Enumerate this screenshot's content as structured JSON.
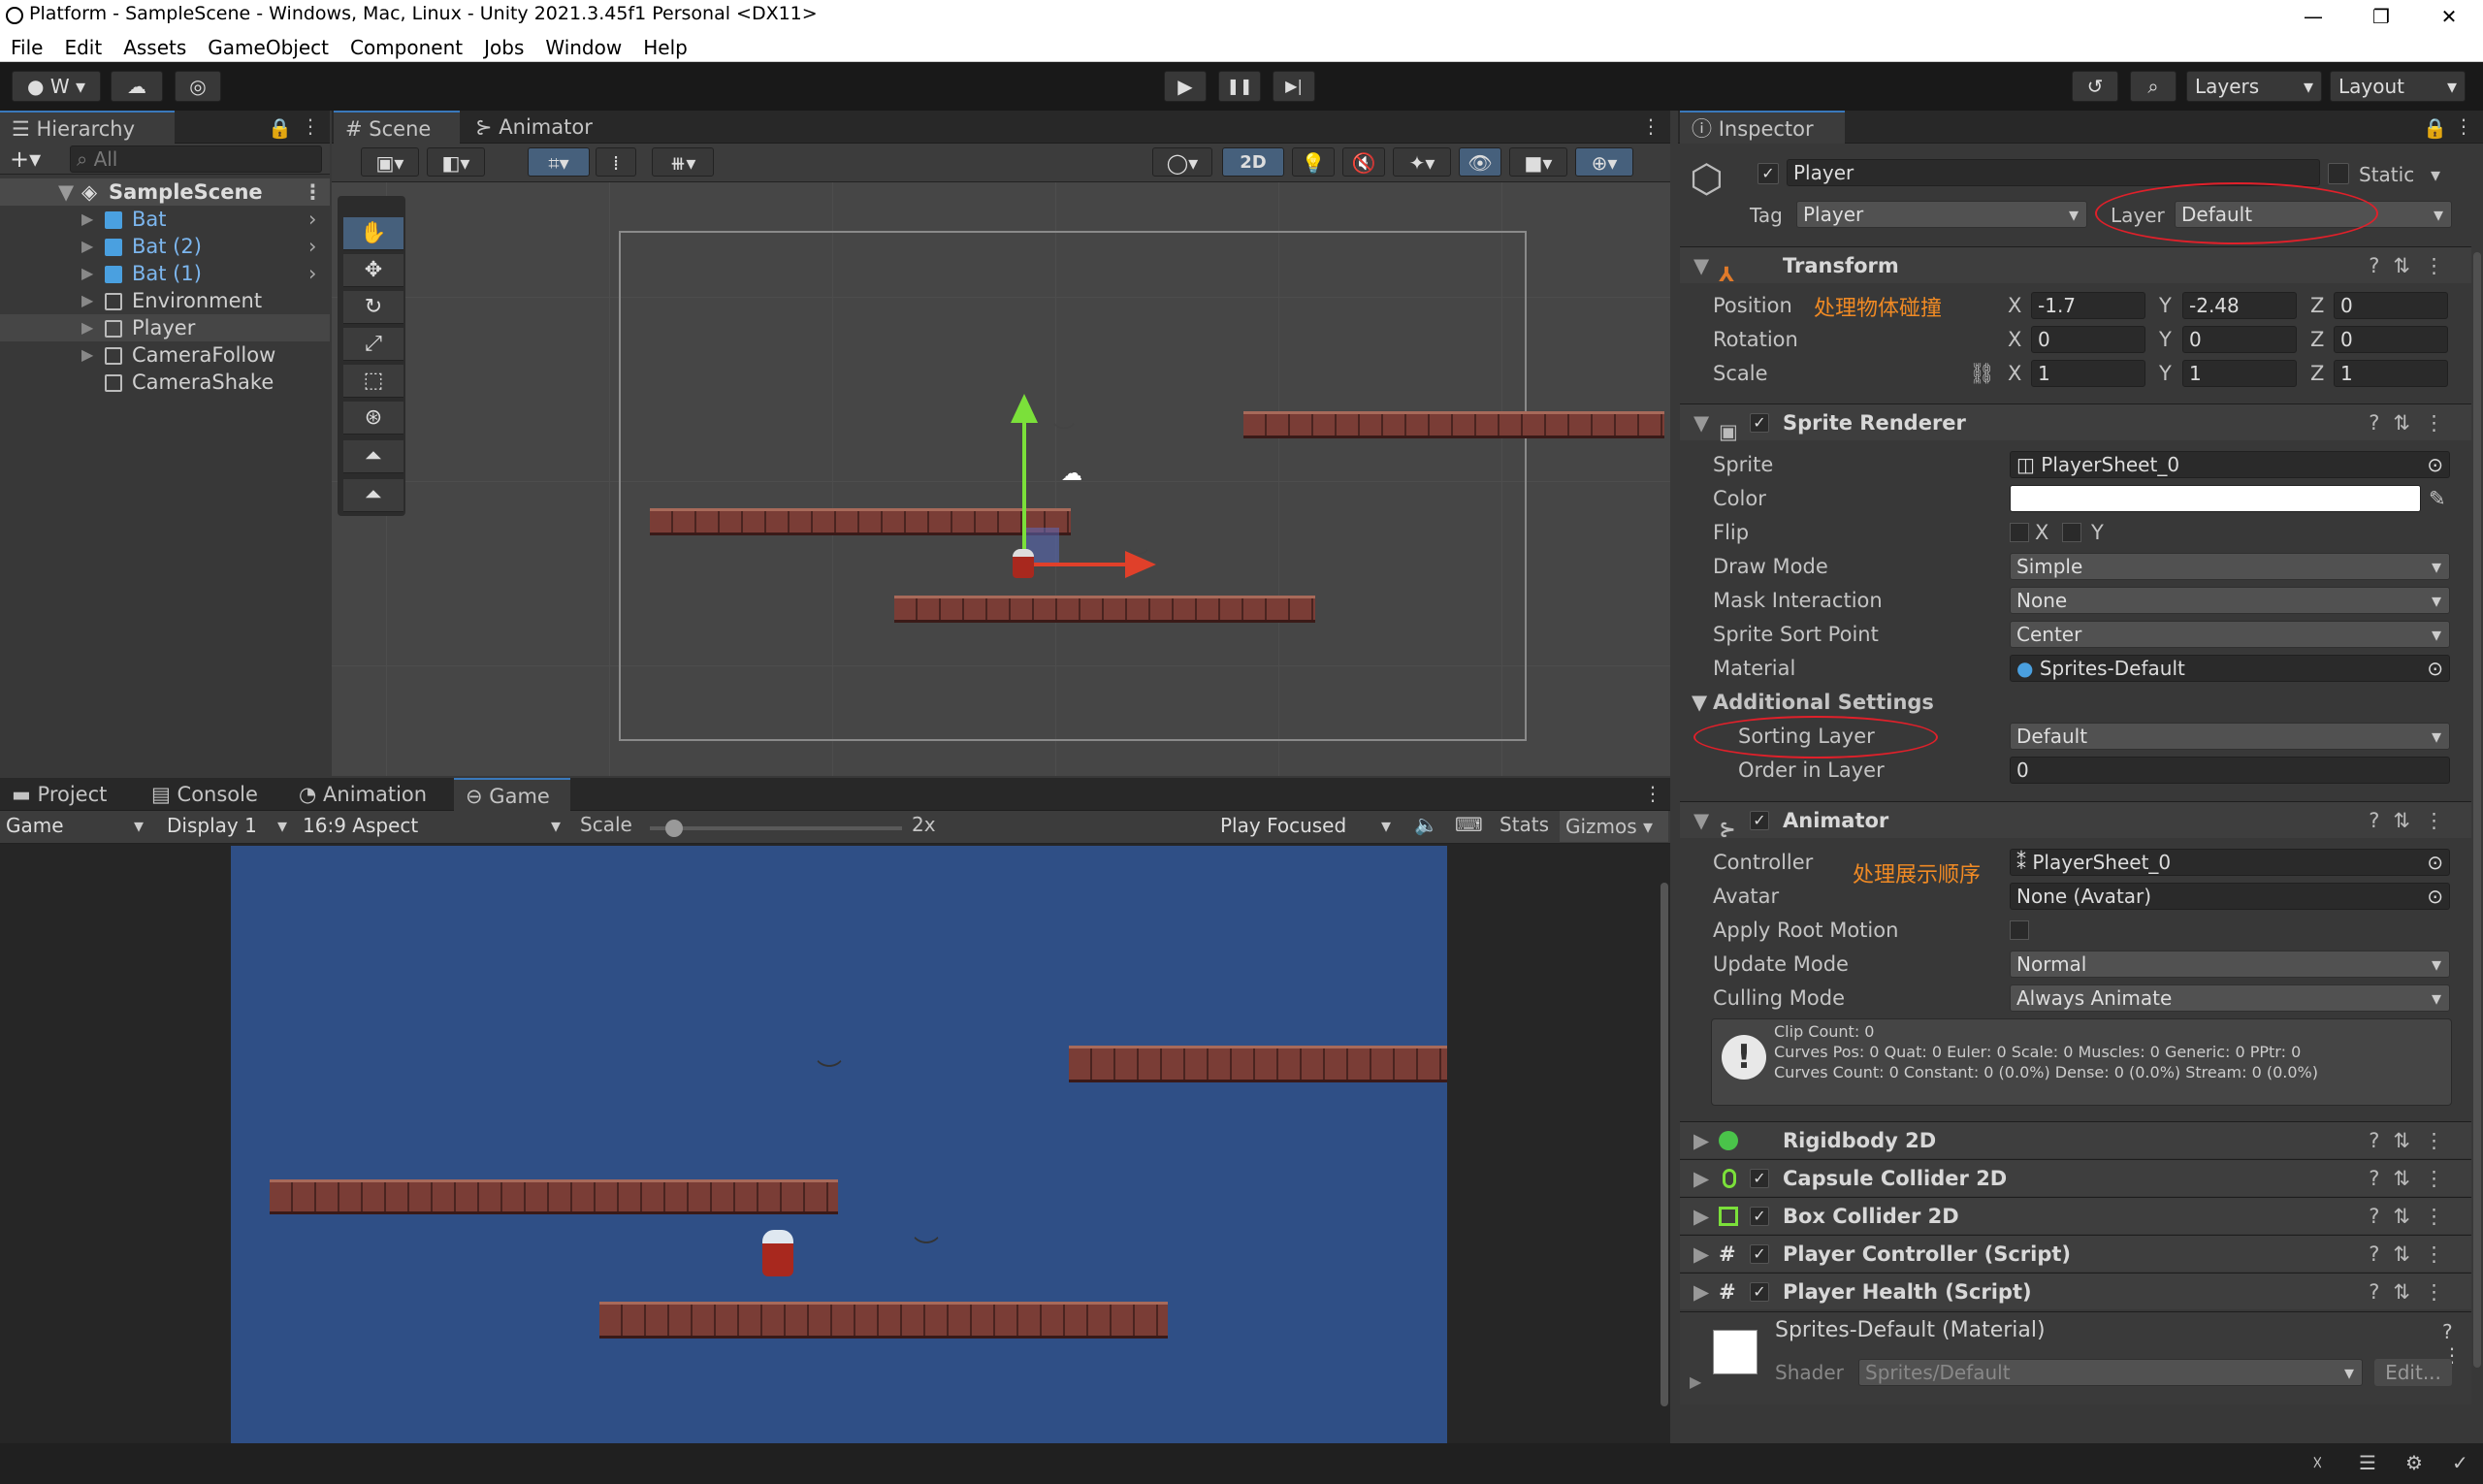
{
  "window": {
    "title": "Platform - SampleScene - Windows, Mac, Linux - Unity 2021.3.45f1 Personal <DX11>",
    "min": "—",
    "max": "❐",
    "close": "✕"
  },
  "menu": [
    "File",
    "Edit",
    "Assets",
    "GameObject",
    "Component",
    "Jobs",
    "Window",
    "Help"
  ],
  "toolbar": {
    "account": "W",
    "layers": "Layers",
    "layout": "Layout",
    "play": "▶",
    "pause": "❚❚",
    "step": "▶|"
  },
  "hierarchy": {
    "tab": "Hierarchy",
    "search_placeholder": "All",
    "scene": "SampleScene",
    "items": [
      {
        "label": "Bat",
        "prefab": true
      },
      {
        "label": "Bat (2)",
        "prefab": true
      },
      {
        "label": "Bat (1)",
        "prefab": true
      },
      {
        "label": "Environment",
        "prefab": false
      },
      {
        "label": "Player",
        "prefab": false
      },
      {
        "label": "CameraFollow",
        "prefab": false
      },
      {
        "label": "CameraShake",
        "prefab": false
      }
    ]
  },
  "scene_tabs": {
    "scene": "Scene",
    "animator": "Animator",
    "mode_2d": "2D"
  },
  "bottom_tabs": {
    "project": "Project",
    "console": "Console",
    "animation": "Animation",
    "game": "Game"
  },
  "game_bar": {
    "game": "Game",
    "display": "Display 1",
    "aspect": "16:9 Aspect",
    "scale_label": "Scale",
    "scale_value": "2x",
    "play_focused": "Play Focused",
    "stats": "Stats",
    "gizmos": "Gizmos"
  },
  "inspector": {
    "tab": "Inspector",
    "object_name": "Player",
    "static_label": "Static",
    "tag_label": "Tag",
    "tag_value": "Player",
    "layer_label": "Layer",
    "layer_value": "Default",
    "transform": {
      "title": "Transform",
      "note": "处理物体碰撞",
      "position_label": "Position",
      "pos": {
        "x": "-1.7",
        "y": "-2.48",
        "z": "0"
      },
      "rotation_label": "Rotation",
      "rot": {
        "x": "0",
        "y": "0",
        "z": "0"
      },
      "scale_label": "Scale",
      "scl": {
        "x": "1",
        "y": "1",
        "z": "1"
      },
      "x": "X",
      "y": "Y",
      "z": "Z"
    },
    "sprite_renderer": {
      "title": "Sprite Renderer",
      "sprite_label": "Sprite",
      "sprite_value": "PlayerSheet_0",
      "color_label": "Color",
      "color_value": "#ffffff",
      "flip_label": "Flip",
      "flip_x": "X",
      "flip_y": "Y",
      "draw_mode_label": "Draw Mode",
      "draw_mode": "Simple",
      "mask_label": "Mask Interaction",
      "mask": "None",
      "sort_point_label": "Sprite Sort Point",
      "sort_point": "Center",
      "material_label": "Material",
      "material": "Sprites-Default",
      "additional": "Additional Settings",
      "sorting_layer_label": "Sorting Layer",
      "sorting_layer": "Default",
      "order_label": "Order in Layer",
      "order": "0"
    },
    "animator": {
      "title": "Animator",
      "note": "处理展示顺序",
      "controller_label": "Controller",
      "controller": "PlayerSheet_0",
      "avatar_label": "Avatar",
      "avatar": "None (Avatar)",
      "root_motion_label": "Apply Root Motion",
      "update_label": "Update Mode",
      "update": "Normal",
      "culling_label": "Culling Mode",
      "culling": "Always Animate",
      "info1": "Clip Count: 0",
      "info2": "Curves Pos: 0 Quat: 0 Euler: 0 Scale: 0 Muscles: 0 Generic: 0 PPtr: 0",
      "info3": "Curves Count: 0 Constant: 0 (0.0%) Dense: 0 (0.0%) Stream: 0 (0.0%)"
    },
    "components": [
      "Rigidbody 2D",
      "Capsule Collider 2D",
      "Box Collider 2D",
      "Player Controller (Script)",
      "Player Health (Script)"
    ],
    "material": {
      "name": "Sprites-Default (Material)",
      "shader_label": "Shader",
      "shader": "Sprites/Default",
      "edit": "Edit..."
    }
  },
  "colors": {
    "accent": "#3a79bb",
    "annotation": "#f08a24",
    "circle": "#e0202a",
    "game_bg": "#2f4f86"
  }
}
